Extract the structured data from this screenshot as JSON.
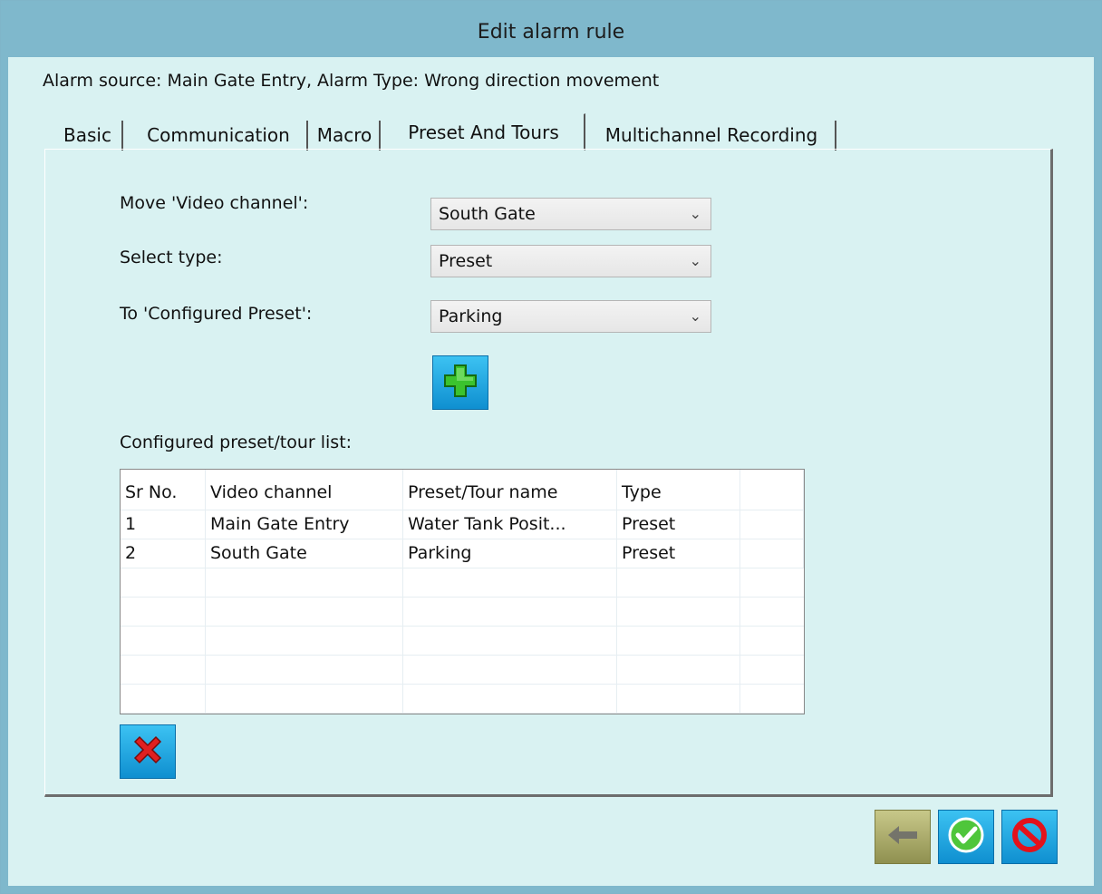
{
  "window": {
    "title": "Edit alarm rule"
  },
  "alarm_source_text": "Alarm source: Main Gate Entry, Alarm Type: Wrong direction movement",
  "tabs": [
    {
      "label": "Basic",
      "active": false
    },
    {
      "label": "Communication",
      "active": false
    },
    {
      "label": "Macro",
      "active": false
    },
    {
      "label": "Preset And Tours",
      "active": true
    },
    {
      "label": "Multichannel Recording",
      "active": false
    }
  ],
  "form": {
    "video_channel_label": "Move 'Video channel':",
    "video_channel_value": "South Gate",
    "select_type_label": "Select type:",
    "select_type_value": "Preset",
    "configured_preset_label": "To 'Configured Preset':",
    "configured_preset_value": "Parking",
    "add_icon": "green-plus-icon"
  },
  "list": {
    "label": "Configured preset/tour list:",
    "columns": [
      "Sr No.",
      "Video channel",
      "Preset/Tour name",
      "Type"
    ],
    "rows": [
      [
        "1",
        "Main Gate Entry",
        "Water Tank Posit...",
        "Preset"
      ],
      [
        "2",
        "South Gate",
        "Parking",
        "Preset"
      ]
    ],
    "delete_icon": "red-x-icon"
  },
  "footer": {
    "back_icon": "back-arrow-icon",
    "ok_icon": "green-check-icon",
    "cancel_icon": "red-no-icon"
  },
  "colors": {
    "title_bar": "#7fb8cc",
    "client_bg": "#d9f2f2",
    "button_blue": "#1aa7e6"
  }
}
